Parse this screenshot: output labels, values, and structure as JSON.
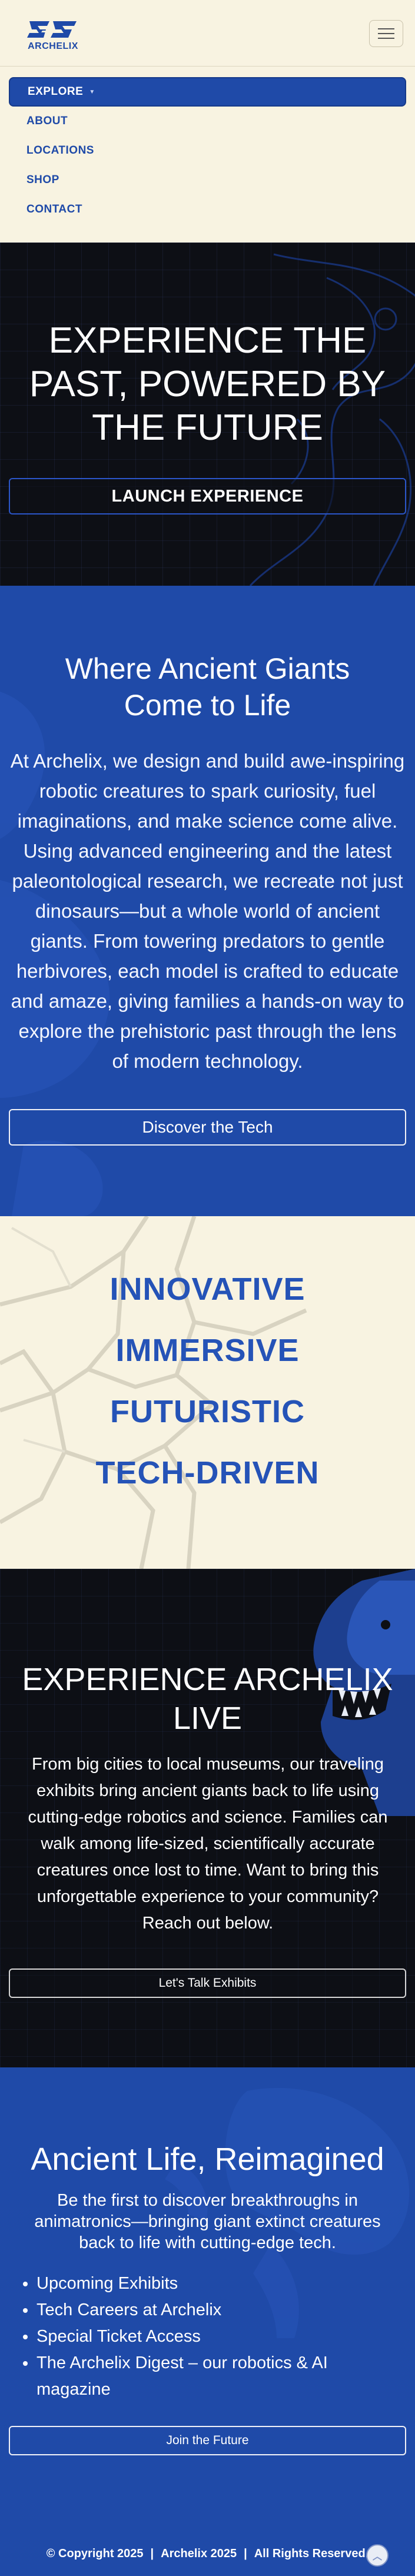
{
  "header": {
    "logo_text": "ARCHELIX",
    "menu_icon": "hamburger-menu-icon"
  },
  "nav": {
    "items": [
      {
        "label": "EXPLORE",
        "active": true,
        "has_dropdown": true
      },
      {
        "label": "ABOUT"
      },
      {
        "label": "LOCATIONS"
      },
      {
        "label": "SHOP"
      },
      {
        "label": "CONTACT"
      }
    ]
  },
  "hero": {
    "title": "EXPERIENCE THE PAST, POWERED BY THE FUTURE",
    "button": "LAUNCH EXPERIENCE"
  },
  "about": {
    "title": "Where Ancient Giants Come to Life",
    "body": "At Archelix, we design and build awe-inspiring robotic creatures to spark curiosity, fuel imaginations, and make science come alive. Using advanced engineering and the latest paleontological research, we recreate not just dinosaurs—but a whole world of ancient giants. From towering predators to gentle herbivores, each model is crafted to educate and amaze, giving families a hands-on way to explore the prehistoric past through the lens of modern technology.",
    "button": "Discover the Tech"
  },
  "values": {
    "words": [
      "INNOVATIVE",
      "IMMERSIVE",
      "FUTURISTIC",
      "TECH-DRIVEN"
    ]
  },
  "live": {
    "title": "EXPERIENCE ARCHELIX LIVE",
    "body": "From big cities to local museums, our traveling exhibits bring ancient giants back to life using cutting-edge robotics and science. Families can walk among life-sized, scientifically accurate creatures once lost to time. Want to bring this unforgettable experience to your community? Reach out below.",
    "button": "Let's Talk Exhibits"
  },
  "news": {
    "title": "Ancient Life, Reimagined",
    "lead": "Be the first to discover breakthroughs in animatronics—bringing giant extinct creatures back to life with cutting-edge tech.",
    "items": [
      "Upcoming Exhibits",
      "Tech Careers at Archelix",
      "Special Ticket Access",
      "The Archelix Digest – our robotics & AI magazine"
    ],
    "button": "Join the Future"
  },
  "footer": {
    "copyright": "© Copyright 2025",
    "brand": "Archelix 2025",
    "rights": "All Rights Reserved.",
    "separator": "|"
  },
  "colors": {
    "brand_blue": "#1f4aa8",
    "cream": "#f8f3e1",
    "dark": "#0d0f15"
  }
}
